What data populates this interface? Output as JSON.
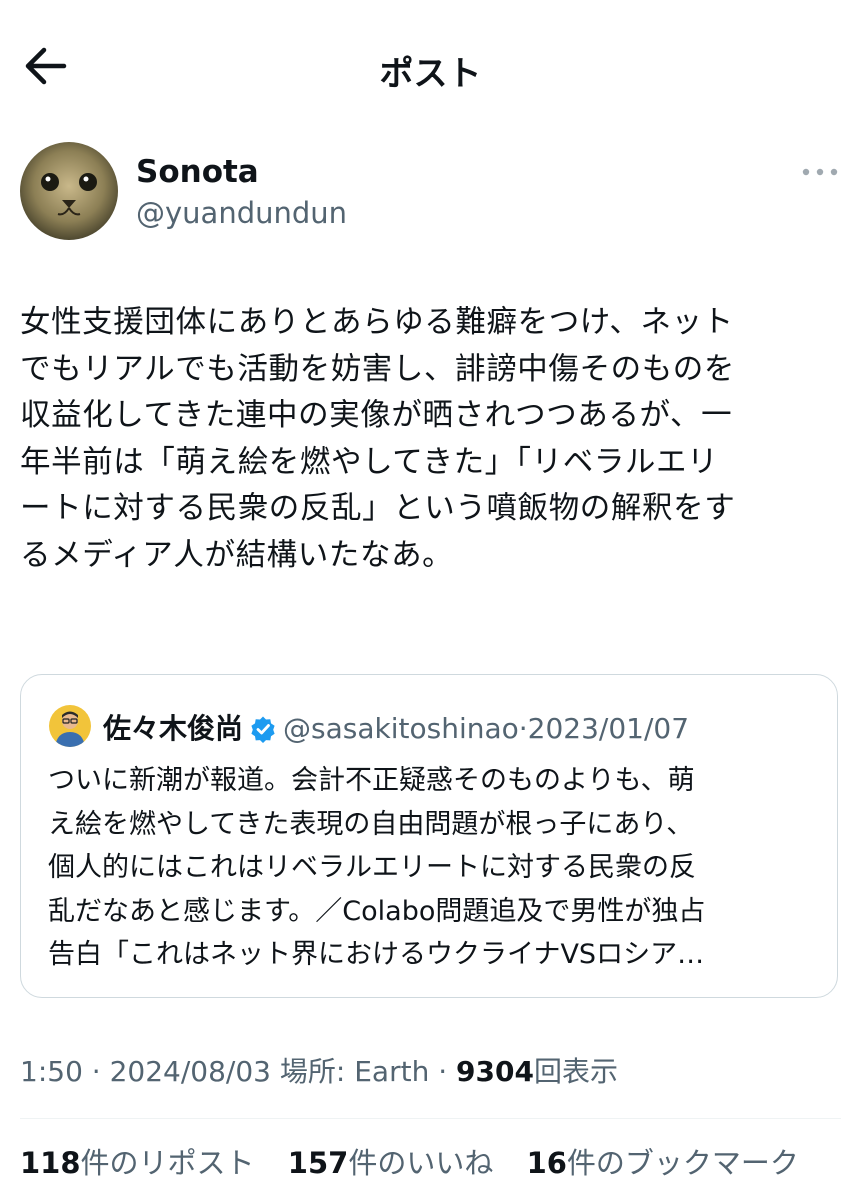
{
  "header": {
    "title": "ポスト",
    "back_icon": "arrow-left-icon"
  },
  "author": {
    "display_name": "Sonota",
    "handle": "@yuandundun",
    "more_icon": "more-dots-icon"
  },
  "tweet": {
    "text": "女性支援団体にありとあらゆる難癖をつけ、ネット\nでもリアルでも活動を妨害し、誹謗中傷そのものを\n収益化してきた連中の実像が晒されつつあるが、一\n年半前は「萌え絵を燃やしてきた」「リベラルエリ\nートに対する民衆の反乱」という噴飯物の解釈をす\nるメディア人が結構いたなあ。"
  },
  "quote": {
    "name": "佐々木俊尚",
    "handle": "@sasakitoshinao",
    "separator": "·",
    "date": "2023/01/07",
    "text": "ついに新潮が報道。会計不正疑惑そのものよりも、萌\nえ絵を燃やしてきた表現の自由問題が根っ子にあり、\n個人的にはこれはリベラルエリートに対する民衆の反\n乱だなあと感じます。／Colabo問題追及で男性が独占\n告白「これはネット界におけるウクライナVSロシア…"
  },
  "meta": {
    "time": "1:50",
    "sep1": "·",
    "date": "2024/08/03",
    "location_label": "場所: Earth",
    "sep2": "·",
    "views_count": "9304",
    "views_label": "回表示"
  },
  "stats": {
    "reposts_count": "118",
    "reposts_label": "件のリポスト",
    "likes_count": "157",
    "likes_label": "件のいいね",
    "bookmarks_count": "16",
    "bookmarks_label": "件のブックマーク"
  },
  "colors": {
    "verified": "#1d9bf0",
    "muted": "#536471",
    "text": "#0f1419",
    "border": "#cfd9de"
  }
}
